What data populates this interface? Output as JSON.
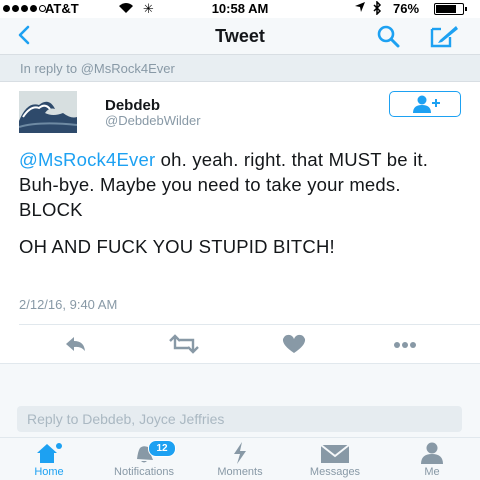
{
  "status_bar": {
    "carrier": "AT&T",
    "time": "10:58 AM",
    "battery_percent": "76%",
    "battery_level": 0.76,
    "signal_bars": 5,
    "signal_bars_filled": 4
  },
  "nav": {
    "title": "Tweet",
    "back_icon": "chevron-left-icon",
    "search_icon": "search-icon",
    "compose_icon": "compose-icon"
  },
  "reply_context": "In reply to @MsRock4Ever",
  "tweet": {
    "display_name": "Debdeb",
    "handle": "@DebdebWilder",
    "mention": "@MsRock4Ever",
    "text_line1": " oh.  yeah.  right. that MUST be it.  Buh-bye.  Maybe you need to take your meds. BLOCK",
    "text_line2": "OH AND FUCK YOU STUPID BITCH!",
    "timestamp": "2/12/16, 9:40 AM"
  },
  "actions": [
    "reply-icon",
    "retweet-icon",
    "like-icon",
    "more-icon"
  ],
  "reply_input": {
    "placeholder": "Reply to Debdeb, Joyce Jeffries",
    "value": ""
  },
  "tabs": [
    {
      "label": "Home",
      "icon": "home-icon",
      "active": true
    },
    {
      "label": "Notifications",
      "icon": "bell-icon",
      "badge": "12"
    },
    {
      "label": "Moments",
      "icon": "lightning-icon"
    },
    {
      "label": "Messages",
      "icon": "envelope-icon"
    },
    {
      "label": "Me",
      "icon": "person-icon"
    }
  ],
  "colors": {
    "accent": "#1da1f2",
    "text": "#14171a",
    "muted": "#8899a6",
    "background": "#f5f8fa"
  }
}
